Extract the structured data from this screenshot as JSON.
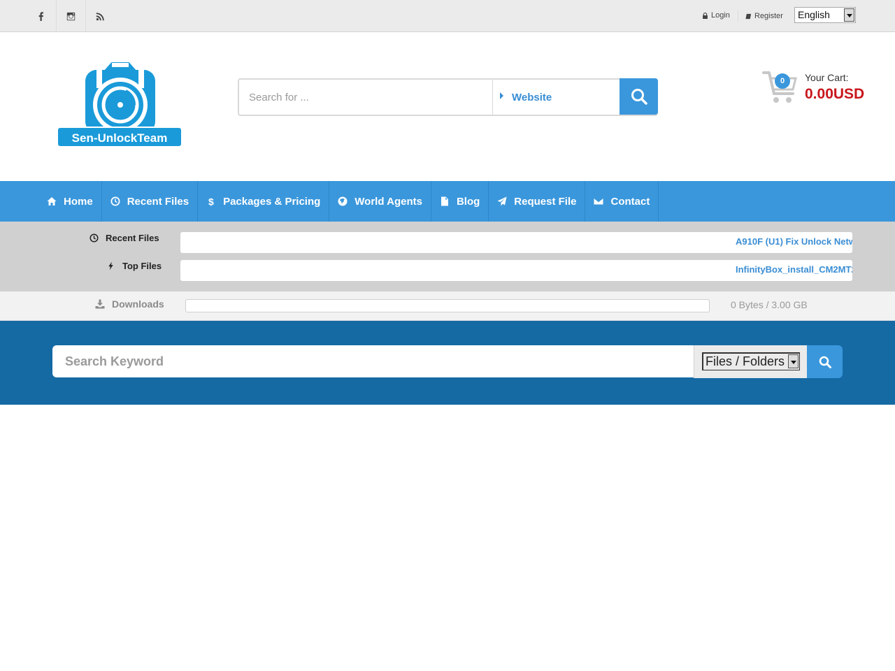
{
  "topbar": {
    "social": [
      {
        "name": "facebook-icon"
      },
      {
        "name": "instagram-icon"
      },
      {
        "name": "rss-icon"
      }
    ],
    "login_label": "Login",
    "register_label": "Register",
    "language": "English"
  },
  "header": {
    "logo_text": "Sen-UnlockTeam",
    "search_placeholder": "Search for ...",
    "search_scope": "Website",
    "cart_count": "0",
    "cart_label": "Your Cart:",
    "cart_total": "0.00USD"
  },
  "nav": {
    "items": [
      {
        "label": "Home",
        "icon": "home-icon"
      },
      {
        "label": "Recent Files",
        "icon": "clock-icon"
      },
      {
        "label": "Packages & Pricing",
        "icon": "dollar-icon"
      },
      {
        "label": "World Agents",
        "icon": "globe-icon"
      },
      {
        "label": "Blog",
        "icon": "document-icon"
      },
      {
        "label": "Request File",
        "icon": "paper-plane-icon"
      },
      {
        "label": "Contact",
        "icon": "envelope-icon"
      }
    ]
  },
  "ticker": {
    "recent_label": "Recent Files",
    "recent_text": "A910F (U1) Fix Unlock Netw",
    "top_label": "Top Files",
    "top_text": "InfinityBox_install_CM2MT2"
  },
  "downloads": {
    "label": "Downloads",
    "progress_fraction": 0,
    "usage_text": "0 Bytes / 3.00 GB"
  },
  "keyword_search": {
    "placeholder": "Search Keyword",
    "type_selected": "Files / Folders"
  },
  "colors": {
    "accent": "#3a97dc",
    "band": "#156aa4",
    "price": "#c8171c"
  }
}
